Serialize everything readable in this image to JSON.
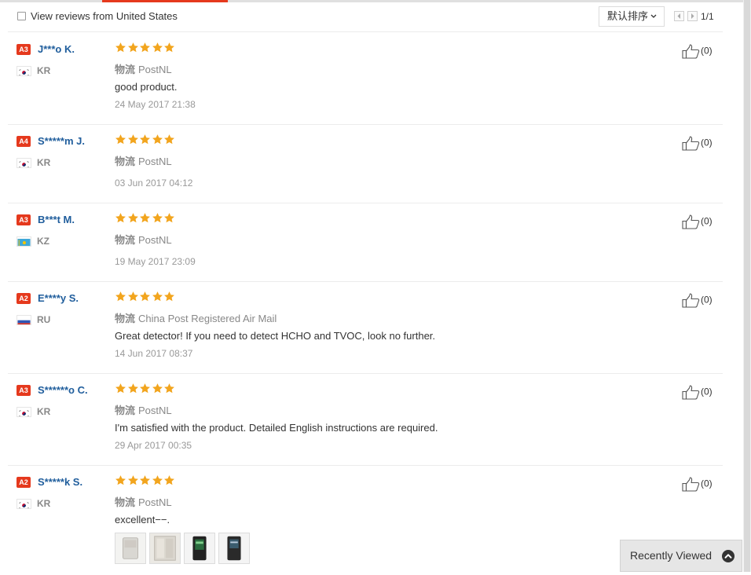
{
  "filter": {
    "checkbox_label": "View reviews from United States",
    "sort_label": "默认排序",
    "prev_icon": "chevron-left-icon",
    "next_icon": "chevron-right-icon",
    "page_indicator": "1/1"
  },
  "colors": {
    "badge_red": "#e5391d",
    "name_blue": "#1f5d9c",
    "star_orange": "#f2a51e"
  },
  "logistics_key": "物流",
  "reviews": [
    {
      "badge": "A3",
      "name": "J***o K.",
      "country": "KR",
      "rating": 5,
      "logistics": "PostNL",
      "comment": "good product.",
      "date": "24 May 2017 21:38",
      "helpful": "(0)"
    },
    {
      "badge": "A4",
      "name": "S*****m J.",
      "country": "KR",
      "rating": 5,
      "logistics": "PostNL",
      "comment": "",
      "date": "03 Jun 2017 04:12",
      "helpful": "(0)"
    },
    {
      "badge": "A3",
      "name": "B***t M.",
      "country": "KZ",
      "rating": 5,
      "logistics": "PostNL",
      "comment": "",
      "date": "19 May 2017 23:09",
      "helpful": "(0)"
    },
    {
      "badge": "A2",
      "name": "E****y S.",
      "country": "RU",
      "rating": 5,
      "logistics": "China Post Registered Air Mail",
      "comment": "Great detector! If you need to detect HCHO and TVOC, look no further.",
      "date": "14 Jun 2017 08:37",
      "helpful": "(0)"
    },
    {
      "badge": "A3",
      "name": "S******o C.",
      "country": "KR",
      "rating": 5,
      "logistics": "PostNL",
      "comment": "I'm satisfied with the product. Detailed English instructions are required.",
      "date": "29 Apr 2017 00:35",
      "helpful": "(0)"
    },
    {
      "badge": "A2",
      "name": "S*****k S.",
      "country": "KR",
      "rating": 5,
      "logistics": "PostNL",
      "comment": "excellent−−.",
      "date": "",
      "helpful": "(0)",
      "photos": 4
    }
  ],
  "recently_viewed": {
    "label": "Recently Viewed",
    "icon": "chevron-up-icon"
  }
}
